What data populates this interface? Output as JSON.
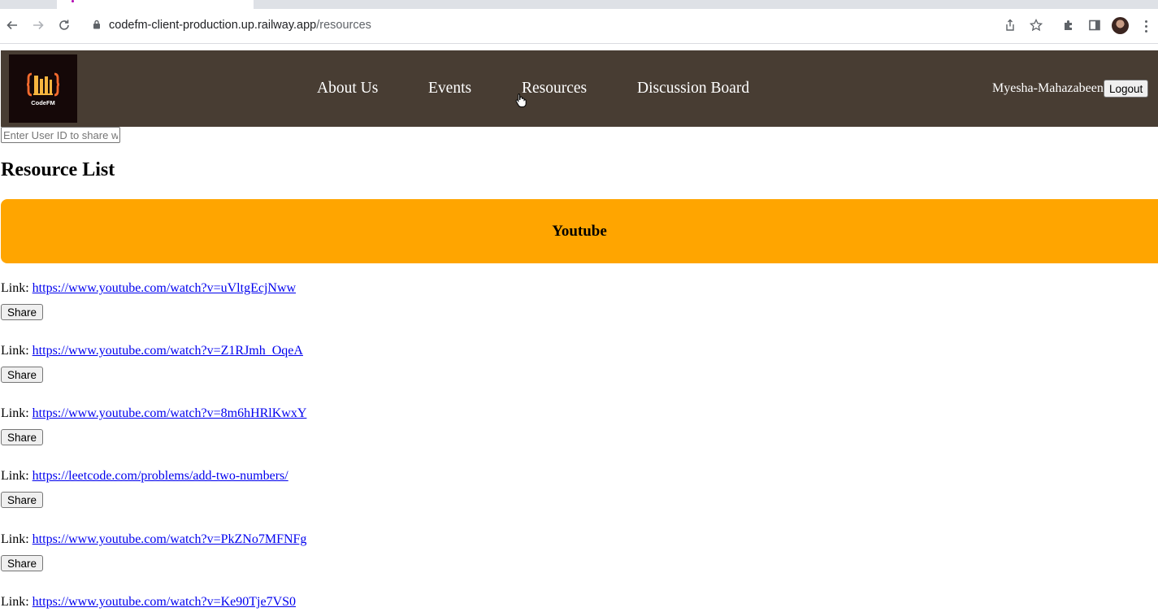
{
  "browser": {
    "url_host": "codefm-client-production.up.railway.app",
    "url_path": "/resources"
  },
  "header": {
    "logo_text": "CodeFM",
    "nav": [
      "About Us",
      "Events",
      "Resources",
      "Discussion Board"
    ],
    "username": "Myesha-Mahazabeen",
    "logout_label": "Logout"
  },
  "share_input_placeholder": "Enter User ID to share w",
  "list_title": "Resource List",
  "category": "Youtube",
  "link_prefix": "Link: ",
  "share_label": "Share",
  "resources": [
    {
      "url": "https://www.youtube.com/watch?v=uVltgEcjNww"
    },
    {
      "url": "https://www.youtube.com/watch?v=Z1RJmh_OqeA"
    },
    {
      "url": "https://www.youtube.com/watch?v=8m6hHRlKwxY"
    },
    {
      "url": "https://leetcode.com/problems/add-two-numbers/"
    },
    {
      "url": "https://www.youtube.com/watch?v=PkZNo7MFNFg"
    },
    {
      "url": "https://www.youtube.com/watch?v=Ke90Tje7VS0"
    }
  ],
  "colors": {
    "header_bg": "#483d33",
    "banner_bg": "#ffa500",
    "link": "#0000ee"
  }
}
